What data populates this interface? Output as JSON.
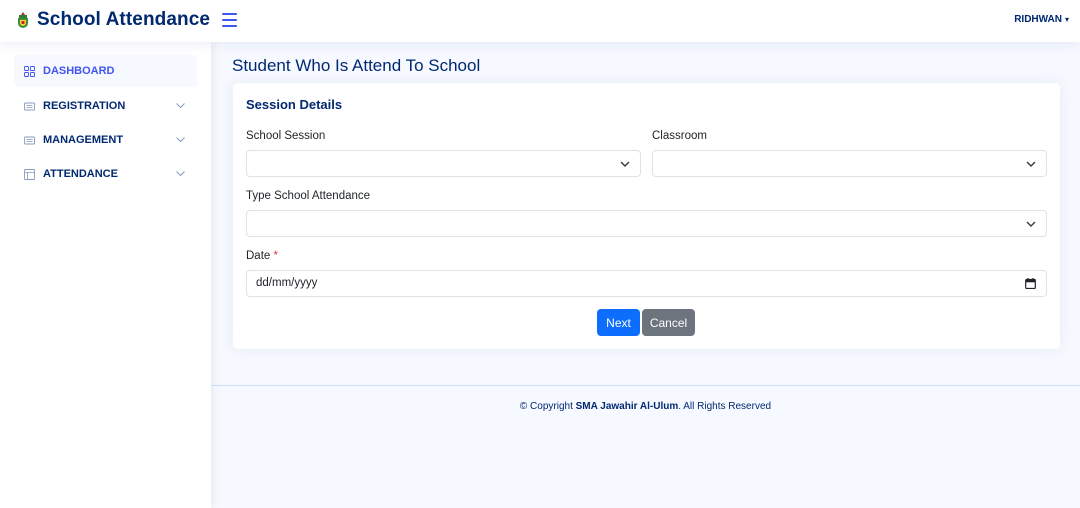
{
  "header": {
    "app_title": "School Attendance",
    "user_name": "RIDHWAN",
    "user_caret": "▾"
  },
  "sidebar": {
    "items": [
      {
        "label": "DASHBOARD",
        "icon": "grid-icon",
        "active": true
      },
      {
        "label": "REGISTRATION",
        "icon": "list-icon",
        "expandable": true
      },
      {
        "label": "MANAGEMENT",
        "icon": "list-icon",
        "expandable": true
      },
      {
        "label": "ATTENDANCE",
        "icon": "layout-icon",
        "expandable": true
      }
    ]
  },
  "main": {
    "page_title": "Student Who Is Attend To School",
    "card": {
      "title": "Session Details",
      "fields": {
        "school_session": {
          "label": "School Session",
          "value": ""
        },
        "classroom": {
          "label": "Classroom",
          "value": ""
        },
        "type_attendance": {
          "label": "Type School Attendance",
          "value": ""
        },
        "date": {
          "label": "Date",
          "required_mark": "*",
          "value": "dd/mm/yyyy"
        }
      },
      "buttons": {
        "next": "Next",
        "cancel": "Cancel"
      }
    }
  },
  "footer": {
    "prefix": "© Copyright ",
    "org": "SMA Jawahir Al-Ulum",
    "suffix": ". All Rights Reserved"
  },
  "colors": {
    "brand": "#012970",
    "accent": "#4154f1",
    "primary_button": "#0d6efd",
    "secondary_button": "#6c757d",
    "required": "#dc3545",
    "background": "#f6f9ff"
  }
}
